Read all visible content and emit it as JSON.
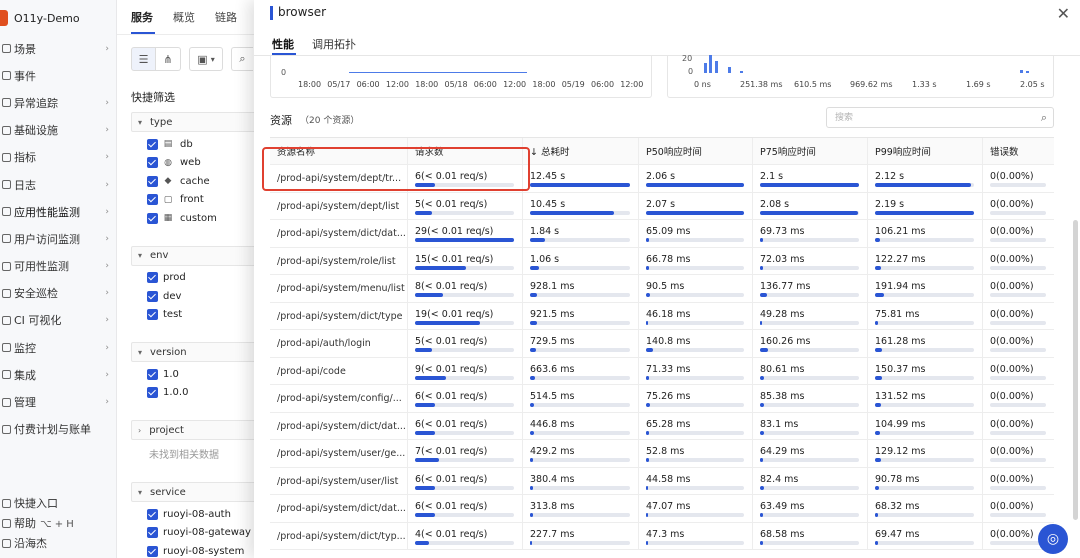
{
  "app": {
    "name": "O11y-Demo"
  },
  "nav": [
    {
      "label": "场景",
      "icon": "scene-icon"
    },
    {
      "label": "事件",
      "icon": "event-icon"
    },
    {
      "label": "异常追踪",
      "icon": "bug-icon"
    },
    {
      "label": "基础设施",
      "icon": "server-icon"
    },
    {
      "label": "指标",
      "icon": "metric-icon"
    },
    {
      "label": "日志",
      "icon": "log-icon"
    },
    {
      "label": "应用性能监测",
      "icon": "apm-icon"
    },
    {
      "label": "用户访问监测",
      "icon": "rum-icon"
    },
    {
      "label": "可用性监测",
      "icon": "dial-icon"
    },
    {
      "label": "安全巡检",
      "icon": "shield-icon"
    },
    {
      "label": "CI 可视化",
      "icon": "ci-icon"
    },
    {
      "label": "监控",
      "icon": "monitor-icon"
    },
    {
      "label": "集成",
      "icon": "integration-icon"
    },
    {
      "label": "管理",
      "icon": "settings-icon"
    },
    {
      "label": "付费计划与账单",
      "icon": "billing-icon"
    }
  ],
  "nav_footer": [
    {
      "label": "快捷入口",
      "kbd": ""
    },
    {
      "label": "帮助",
      "kbd": "⌥ + H"
    },
    {
      "label": "沿海杰",
      "kbd": ""
    }
  ],
  "top_tabs": [
    "服务",
    "概览",
    "链路"
  ],
  "filter": {
    "title": "快捷筛选",
    "groups": [
      {
        "name": "type",
        "items": [
          "db",
          "web",
          "cache",
          "front",
          "custom"
        ]
      },
      {
        "name": "env",
        "items": [
          "prod",
          "dev",
          "test"
        ]
      },
      {
        "name": "version",
        "items": [
          "1.0",
          "1.0.0"
        ]
      },
      {
        "name": "project",
        "items": [],
        "empty": "未找到相关数据"
      },
      {
        "name": "service",
        "items": [
          "ruoyi-08-auth",
          "ruoyi-08-gateway",
          "ruoyi-08-system"
        ]
      }
    ]
  },
  "drawer": {
    "title": "browser",
    "tabs": [
      "性能",
      "调用拓扑"
    ],
    "left_chart": {
      "y_label": "0",
      "x_ticks": [
        "18:00",
        "05/17",
        "06:00",
        "12:00",
        "18:00",
        "05/18",
        "06:00",
        "12:00",
        "18:00",
        "05/19",
        "06:00",
        "12:00"
      ]
    },
    "right_chart": {
      "y_ticks": [
        "20",
        "0"
      ],
      "x_ticks": [
        "0 ns",
        "251.38 ms",
        "610.5 ms",
        "969.62 ms",
        "1.33 s",
        "1.69 s",
        "2.05 s"
      ]
    },
    "resources": {
      "title": "资源",
      "count": "（20 个资源）",
      "search_placeholder": "搜索",
      "columns": [
        "资源名称",
        "请求数",
        "↓ 总耗时",
        "P50响应时间",
        "P75响应时间",
        "P99响应时间",
        "错误数"
      ],
      "rows": [
        {
          "name": "/prod-api/system/dept/tr...",
          "req": "6(< 0.01 req/s)",
          "req_pct": 0.2,
          "total": "12.45 s",
          "total_pct": 1.0,
          "p50": "2.06 s",
          "p50_pct": 1.0,
          "p75": "2.1 s",
          "p75_pct": 1.0,
          "p99": "2.12 s",
          "p99_pct": 0.97,
          "err": "0(0.00%)",
          "err_pct": 0
        },
        {
          "name": "/prod-api/system/dept/list",
          "req": "5(< 0.01 req/s)",
          "req_pct": 0.17,
          "total": "10.45 s",
          "total_pct": 0.84,
          "p50": "2.07 s",
          "p50_pct": 1.0,
          "p75": "2.08 s",
          "p75_pct": 0.99,
          "p99": "2.19 s",
          "p99_pct": 1.0,
          "err": "0(0.00%)",
          "err_pct": 0
        },
        {
          "name": "/prod-api/system/dict/dat...",
          "req": "29(< 0.01 req/s)",
          "req_pct": 1.0,
          "total": "1.84 s",
          "total_pct": 0.15,
          "p50": "65.09 ms",
          "p50_pct": 0.03,
          "p75": "69.73 ms",
          "p75_pct": 0.03,
          "p99": "106.21 ms",
          "p99_pct": 0.05,
          "err": "0(0.00%)",
          "err_pct": 0
        },
        {
          "name": "/prod-api/system/role/list",
          "req": "15(< 0.01 req/s)",
          "req_pct": 0.52,
          "total": "1.06 s",
          "total_pct": 0.09,
          "p50": "66.78 ms",
          "p50_pct": 0.03,
          "p75": "72.03 ms",
          "p75_pct": 0.03,
          "p99": "122.27 ms",
          "p99_pct": 0.06,
          "err": "0(0.00%)",
          "err_pct": 0
        },
        {
          "name": "/prod-api/system/menu/list",
          "req": "8(< 0.01 req/s)",
          "req_pct": 0.28,
          "total": "928.1 ms",
          "total_pct": 0.07,
          "p50": "90.5 ms",
          "p50_pct": 0.04,
          "p75": "136.77 ms",
          "p75_pct": 0.07,
          "p99": "191.94 ms",
          "p99_pct": 0.09,
          "err": "0(0.00%)",
          "err_pct": 0
        },
        {
          "name": "/prod-api/system/dict/type",
          "req": "19(< 0.01 req/s)",
          "req_pct": 0.66,
          "total": "921.5 ms",
          "total_pct": 0.07,
          "p50": "46.18 ms",
          "p50_pct": 0.02,
          "p75": "49.28 ms",
          "p75_pct": 0.02,
          "p99": "75.81 ms",
          "p99_pct": 0.03,
          "err": "0(0.00%)",
          "err_pct": 0
        },
        {
          "name": "/prod-api/auth/login",
          "req": "5(< 0.01 req/s)",
          "req_pct": 0.17,
          "total": "729.5 ms",
          "total_pct": 0.06,
          "p50": "140.8 ms",
          "p50_pct": 0.07,
          "p75": "160.26 ms",
          "p75_pct": 0.08,
          "p99": "161.28 ms",
          "p99_pct": 0.07,
          "err": "0(0.00%)",
          "err_pct": 0
        },
        {
          "name": "/prod-api/code",
          "req": "9(< 0.01 req/s)",
          "req_pct": 0.31,
          "total": "663.6 ms",
          "total_pct": 0.05,
          "p50": "71.33 ms",
          "p50_pct": 0.03,
          "p75": "80.61 ms",
          "p75_pct": 0.04,
          "p99": "150.37 ms",
          "p99_pct": 0.07,
          "err": "0(0.00%)",
          "err_pct": 0
        },
        {
          "name": "/prod-api/system/config/...",
          "req": "6(< 0.01 req/s)",
          "req_pct": 0.2,
          "total": "514.5 ms",
          "total_pct": 0.04,
          "p50": "75.26 ms",
          "p50_pct": 0.04,
          "p75": "85.38 ms",
          "p75_pct": 0.04,
          "p99": "131.52 ms",
          "p99_pct": 0.06,
          "err": "0(0.00%)",
          "err_pct": 0
        },
        {
          "name": "/prod-api/system/dict/dat...",
          "req": "6(< 0.01 req/s)",
          "req_pct": 0.2,
          "total": "446.8 ms",
          "total_pct": 0.04,
          "p50": "65.28 ms",
          "p50_pct": 0.03,
          "p75": "83.1 ms",
          "p75_pct": 0.04,
          "p99": "104.99 ms",
          "p99_pct": 0.05,
          "err": "0(0.00%)",
          "err_pct": 0
        },
        {
          "name": "/prod-api/system/user/ge...",
          "req": "7(< 0.01 req/s)",
          "req_pct": 0.24,
          "total": "429.2 ms",
          "total_pct": 0.03,
          "p50": "52.8 ms",
          "p50_pct": 0.03,
          "p75": "64.29 ms",
          "p75_pct": 0.03,
          "p99": "129.12 ms",
          "p99_pct": 0.06,
          "err": "0(0.00%)",
          "err_pct": 0
        },
        {
          "name": "/prod-api/system/user/list",
          "req": "6(< 0.01 req/s)",
          "req_pct": 0.2,
          "total": "380.4 ms",
          "total_pct": 0.03,
          "p50": "44.58 ms",
          "p50_pct": 0.02,
          "p75": "82.4 ms",
          "p75_pct": 0.04,
          "p99": "90.78 ms",
          "p99_pct": 0.04,
          "err": "0(0.00%)",
          "err_pct": 0
        },
        {
          "name": "/prod-api/system/dict/dat...",
          "req": "6(< 0.01 req/s)",
          "req_pct": 0.2,
          "total": "313.8 ms",
          "total_pct": 0.03,
          "p50": "47.07 ms",
          "p50_pct": 0.02,
          "p75": "63.49 ms",
          "p75_pct": 0.03,
          "p99": "68.32 ms",
          "p99_pct": 0.03,
          "err": "0(0.00%)",
          "err_pct": 0
        },
        {
          "name": "/prod-api/system/dict/typ...",
          "req": "4(< 0.01 req/s)",
          "req_pct": 0.14,
          "total": "227.7 ms",
          "total_pct": 0.02,
          "p50": "47.3 ms",
          "p50_pct": 0.02,
          "p75": "68.58 ms",
          "p75_pct": 0.03,
          "p99": "69.47 ms",
          "p99_pct": 0.03,
          "err": "0(0.00%)",
          "err_pct": 0
        }
      ]
    }
  },
  "colors": {
    "accent": "#2a55d4",
    "highlight": "#e04030",
    "brand": "#e04f1f"
  }
}
